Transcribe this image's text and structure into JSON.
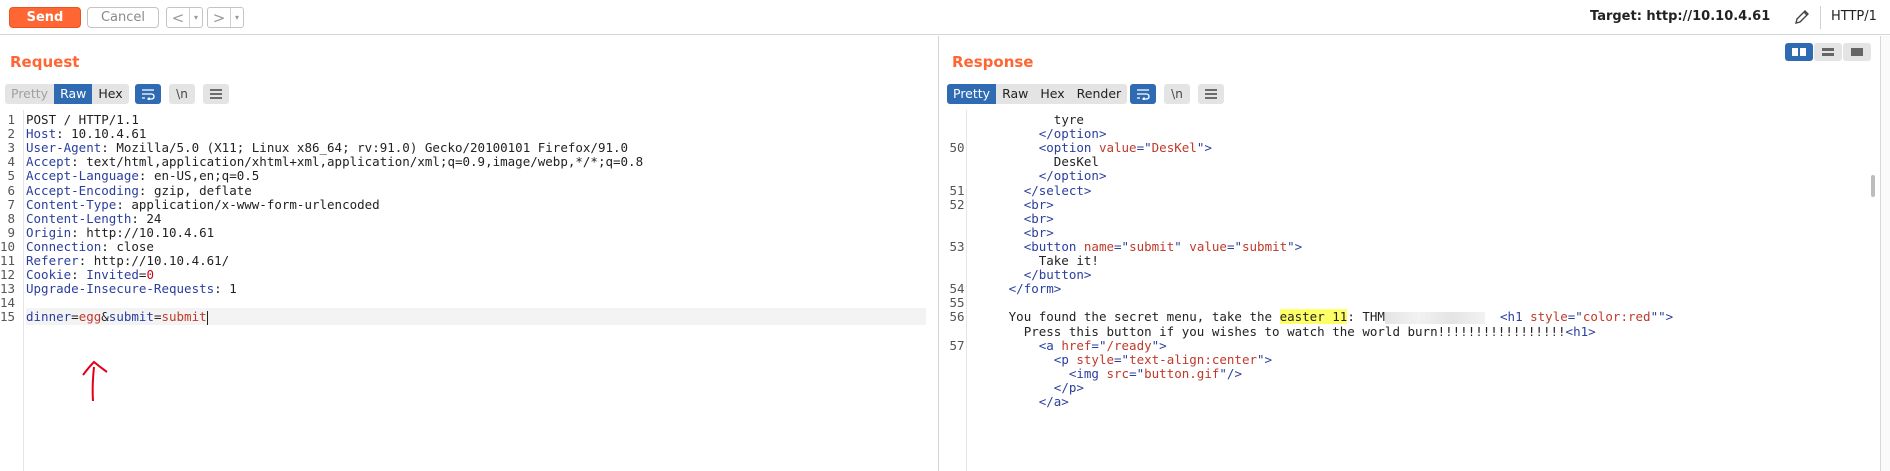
{
  "toolbar": {
    "send_label": "Send",
    "cancel_label": "Cancel",
    "back_glyph": "<",
    "forward_glyph": ">",
    "dropdown_glyph": "▾",
    "target_label": "Target: http://10.10.4.61",
    "http_version": "HTTP/1"
  },
  "request": {
    "title": "Request",
    "tabs": [
      "Pretty",
      "Raw",
      "Hex"
    ],
    "active_tab": "Raw",
    "wrap_icon": "wrap-lines-icon",
    "newline_label": "\\n",
    "menu_icon": "hamburger-menu-icon",
    "lines": [
      {
        "n": "1",
        "parts": [
          {
            "c": "hv",
            "t": "POST / HTTP/1.1"
          }
        ]
      },
      {
        "n": "2",
        "parts": [
          {
            "c": "hk",
            "t": "Host"
          },
          {
            "c": "hv",
            "t": ": 10.10.4.61"
          }
        ]
      },
      {
        "n": "3",
        "parts": [
          {
            "c": "hk",
            "t": "User-Agent"
          },
          {
            "c": "hv",
            "t": ": Mozilla/5.0 (X11; Linux x86_64; rv:91.0) Gecko/20100101 Firefox/91.0"
          }
        ]
      },
      {
        "n": "4",
        "parts": [
          {
            "c": "hk",
            "t": "Accept"
          },
          {
            "c": "hv",
            "t": ": text/html,application/xhtml+xml,application/xml;q=0.9,image/webp,*/*;q=0.8"
          }
        ]
      },
      {
        "n": "5",
        "parts": [
          {
            "c": "hk",
            "t": "Accept-Language"
          },
          {
            "c": "hv",
            "t": ": en-US,en;q=0.5"
          }
        ]
      },
      {
        "n": "6",
        "parts": [
          {
            "c": "hk",
            "t": "Accept-Encoding"
          },
          {
            "c": "hv",
            "t": ": gzip, deflate"
          }
        ]
      },
      {
        "n": "7",
        "parts": [
          {
            "c": "hk",
            "t": "Content-Type"
          },
          {
            "c": "hv",
            "t": ": application/x-www-form-urlencoded"
          }
        ]
      },
      {
        "n": "8",
        "parts": [
          {
            "c": "hk",
            "t": "Content-Length"
          },
          {
            "c": "hv",
            "t": ": 24"
          }
        ]
      },
      {
        "n": "9",
        "parts": [
          {
            "c": "hk",
            "t": "Origin"
          },
          {
            "c": "hv",
            "t": ": http://10.10.4.61"
          }
        ]
      },
      {
        "n": "10",
        "parts": [
          {
            "c": "hk",
            "t": "Connection"
          },
          {
            "c": "hv",
            "t": ": close"
          }
        ]
      },
      {
        "n": "11",
        "parts": [
          {
            "c": "hk",
            "t": "Referer"
          },
          {
            "c": "hv",
            "t": ": http://10.10.4.61/"
          }
        ]
      },
      {
        "n": "12",
        "parts": [
          {
            "c": "hk",
            "t": "Cookie"
          },
          {
            "c": "hv",
            "t": ": "
          },
          {
            "c": "hk",
            "t": "Invited"
          },
          {
            "c": "hv",
            "t": "="
          },
          {
            "c": "num",
            "t": "0"
          }
        ]
      },
      {
        "n": "13",
        "parts": [
          {
            "c": "hk",
            "t": "Upgrade-Insecure-Requests"
          },
          {
            "c": "hv",
            "t": ": 1"
          }
        ]
      },
      {
        "n": "14",
        "parts": []
      },
      {
        "n": "15",
        "highlight": true,
        "parts": [
          {
            "c": "pk",
            "t": "dinner"
          },
          {
            "c": "hv",
            "t": "="
          },
          {
            "c": "pv",
            "t": "egg"
          },
          {
            "c": "hv",
            "t": "&"
          },
          {
            "c": "pk",
            "t": "submit"
          },
          {
            "c": "hv",
            "t": "="
          },
          {
            "c": "pv",
            "t": "submit"
          }
        ]
      }
    ]
  },
  "response": {
    "title": "Response",
    "tabs": [
      "Pretty",
      "Raw",
      "Hex",
      "Render"
    ],
    "active_tab": "Pretty",
    "newline_label": "\\n",
    "lines": [
      {
        "n": "",
        "indent": 11,
        "parts": [
          {
            "c": "txt",
            "t": "tyre"
          }
        ]
      },
      {
        "n": "",
        "indent": 9,
        "parts": [
          {
            "c": "tag",
            "t": "</option>"
          }
        ]
      },
      {
        "n": "50",
        "indent": 9,
        "parts": [
          {
            "c": "tag",
            "t": "<option "
          },
          {
            "c": "attr",
            "t": "value"
          },
          {
            "c": "tag",
            "t": "=\""
          },
          {
            "c": "attr",
            "t": "DesKel"
          },
          {
            "c": "tag",
            "t": "\">"
          }
        ]
      },
      {
        "n": "",
        "indent": 11,
        "parts": [
          {
            "c": "txt",
            "t": "DesKel"
          }
        ]
      },
      {
        "n": "",
        "indent": 9,
        "parts": [
          {
            "c": "tag",
            "t": "</option>"
          }
        ]
      },
      {
        "n": "51",
        "indent": 7,
        "parts": [
          {
            "c": "tag",
            "t": "</select>"
          }
        ]
      },
      {
        "n": "52",
        "indent": 7,
        "parts": [
          {
            "c": "tag",
            "t": "<br>"
          }
        ]
      },
      {
        "n": "",
        "indent": 7,
        "parts": [
          {
            "c": "tag",
            "t": "<br>"
          }
        ]
      },
      {
        "n": "",
        "indent": 7,
        "parts": [
          {
            "c": "tag",
            "t": "<br>"
          }
        ]
      },
      {
        "n": "53",
        "indent": 7,
        "parts": [
          {
            "c": "tag",
            "t": "<button "
          },
          {
            "c": "attr",
            "t": "name"
          },
          {
            "c": "tag",
            "t": "=\""
          },
          {
            "c": "attr",
            "t": "submit"
          },
          {
            "c": "tag",
            "t": "\" "
          },
          {
            "c": "attr",
            "t": "value"
          },
          {
            "c": "tag",
            "t": "=\""
          },
          {
            "c": "attr",
            "t": "submit"
          },
          {
            "c": "tag",
            "t": "\">"
          }
        ]
      },
      {
        "n": "",
        "indent": 9,
        "parts": [
          {
            "c": "txt",
            "t": "Take it!"
          }
        ]
      },
      {
        "n": "",
        "indent": 7,
        "parts": [
          {
            "c": "tag",
            "t": "</button>"
          }
        ]
      },
      {
        "n": "54",
        "indent": 5,
        "parts": [
          {
            "c": "tag",
            "t": "</form>"
          }
        ]
      },
      {
        "n": "55",
        "indent": 0,
        "parts": []
      },
      {
        "n": "56",
        "indent": 5,
        "parts": [
          {
            "c": "txt",
            "t": "You found the secret menu, take the "
          },
          {
            "c": "easter",
            "t": "easter 11"
          },
          {
            "c": "txt",
            "t": ": THM"
          },
          {
            "c": "blur",
            "t": ""
          },
          {
            "c": "txt",
            "t": "  "
          },
          {
            "c": "tag",
            "t": "<h1 "
          },
          {
            "c": "attr",
            "t": "style"
          },
          {
            "c": "tag",
            "t": "=\""
          },
          {
            "c": "attr",
            "t": "color:red"
          },
          {
            "c": "tag",
            "t": "\"\">"
          }
        ]
      },
      {
        "n": "",
        "indent": 7,
        "parts": [
          {
            "c": "txt",
            "t": "Press this button if you wishes to watch the world burn!!!!!!!!!!!!!!!!!"
          },
          {
            "c": "tag",
            "t": "<h1>"
          }
        ]
      },
      {
        "n": "57",
        "indent": 9,
        "parts": [
          {
            "c": "tag",
            "t": "<a "
          },
          {
            "c": "attr",
            "t": "href"
          },
          {
            "c": "tag",
            "t": "=\""
          },
          {
            "c": "attr",
            "t": "/ready"
          },
          {
            "c": "tag",
            "t": "\">"
          }
        ]
      },
      {
        "n": "",
        "indent": 11,
        "parts": [
          {
            "c": "tag",
            "t": "<p "
          },
          {
            "c": "attr",
            "t": "style"
          },
          {
            "c": "tag",
            "t": "=\""
          },
          {
            "c": "attr",
            "t": "text-align:center"
          },
          {
            "c": "tag",
            "t": "\">"
          }
        ]
      },
      {
        "n": "",
        "indent": 13,
        "parts": [
          {
            "c": "tag",
            "t": "<img "
          },
          {
            "c": "attr",
            "t": "src"
          },
          {
            "c": "tag",
            "t": "=\""
          },
          {
            "c": "attr",
            "t": "button.gif"
          },
          {
            "c": "tag",
            "t": "\"/>"
          }
        ]
      },
      {
        "n": "",
        "indent": 11,
        "parts": [
          {
            "c": "tag",
            "t": "</p>"
          }
        ]
      },
      {
        "n": "",
        "indent": 9,
        "parts": [
          {
            "c": "tag",
            "t": "</a>"
          }
        ]
      }
    ]
  },
  "colors": {
    "accent": "#ff6633",
    "active_tab": "#2f6bb3",
    "annotation": "#e0001b"
  }
}
